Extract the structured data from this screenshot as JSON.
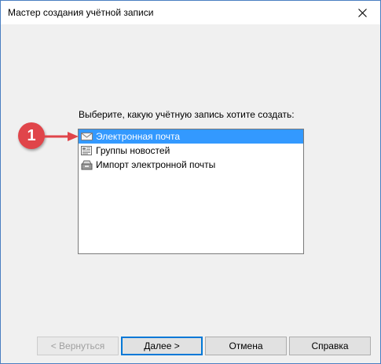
{
  "window": {
    "title": "Мастер создания учётной записи"
  },
  "prompt": "Выберите, какую учётную запись хотите создать:",
  "list": {
    "items": [
      {
        "label": "Электронная почта",
        "icon": "envelope-icon",
        "selected": true
      },
      {
        "label": "Группы новостей",
        "icon": "newsgroup-icon",
        "selected": false
      },
      {
        "label": "Импорт электронной почты",
        "icon": "inbox-import-icon",
        "selected": false
      }
    ]
  },
  "annotation": {
    "number": "1",
    "color": "#e0454a"
  },
  "buttons": {
    "back": "< Вернуться",
    "next": "Далее >",
    "cancel": "Отмена",
    "help": "Справка"
  },
  "colors": {
    "selection": "#3399ff",
    "accent": "#0078d7"
  }
}
